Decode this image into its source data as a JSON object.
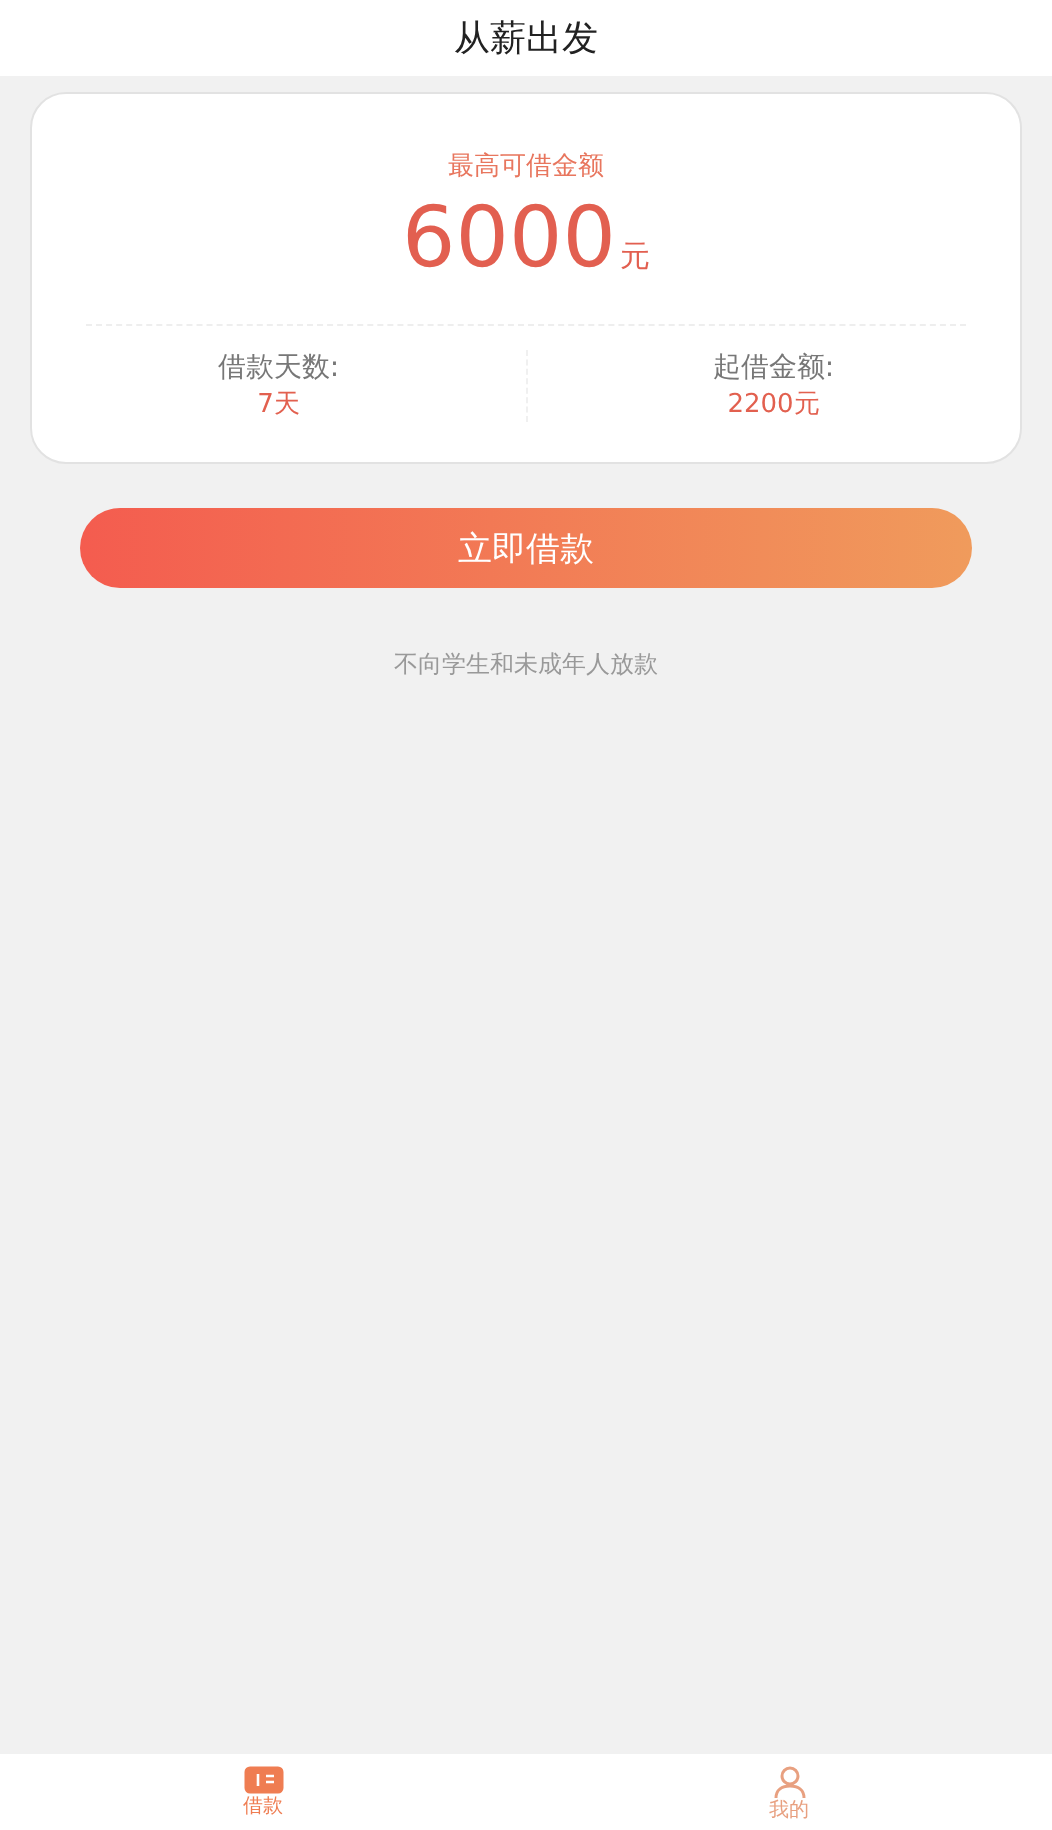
{
  "header": {
    "title": "从薪出发"
  },
  "card": {
    "label": "最高可借金额",
    "amount": "6000",
    "unit": "元",
    "details": [
      {
        "label": "借款天数:",
        "value": "7天"
      },
      {
        "label": "起借金额:",
        "value": "2200元"
      }
    ]
  },
  "apply_button": "立即借款",
  "notice": "不向学生和未成年人放款",
  "tabs": [
    {
      "label": "借款",
      "kind": "loan",
      "selected": true
    },
    {
      "label": "我的",
      "kind": "profile",
      "selected": false
    }
  ]
}
